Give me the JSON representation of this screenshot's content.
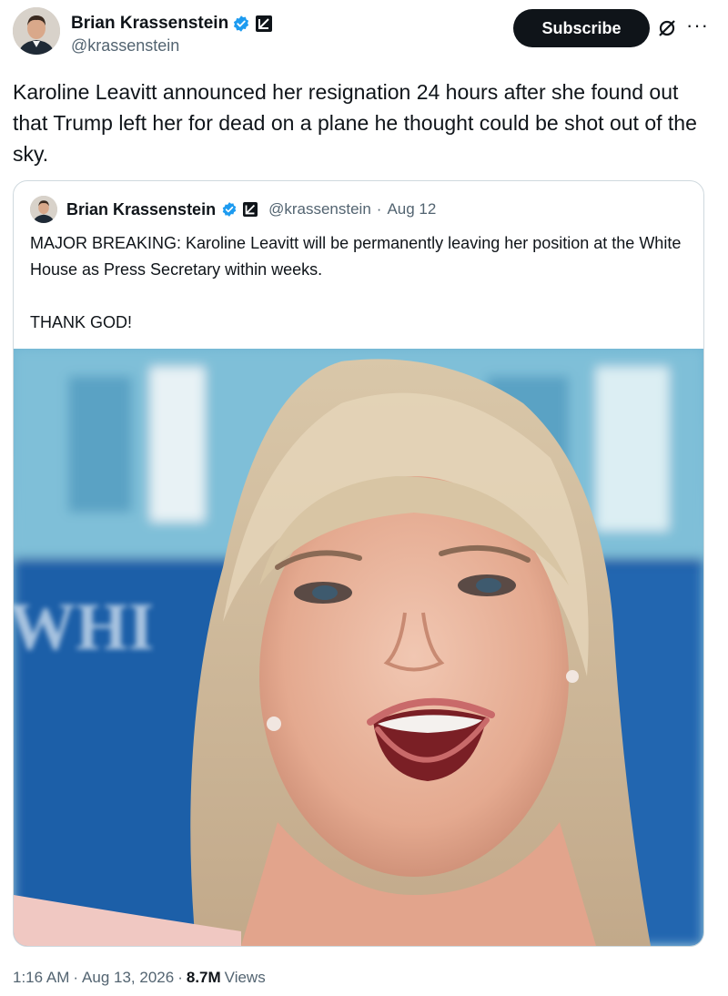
{
  "post": {
    "author_name": "Brian Krassenstein",
    "handle": "@krassenstein",
    "subscribe_label": "Subscribe",
    "more_label": "···",
    "text": "Karoline Leavitt announced her resignation 24 hours after she found out that Trump left her for dead on a plane he thought could be shot out of the sky.",
    "time": "1:16 AM",
    "date": "Aug 13, 2026",
    "separator": "·",
    "views_count": "8.7M",
    "views_label": "Views"
  },
  "quote": {
    "author_name": "Brian Krassenstein",
    "handle": "@krassenstein",
    "separator": "·",
    "date": "Aug 12",
    "text_line1": "MAJOR BREAKING:  Karoline Leavitt will be permanently leaving her position at the White House as Press Secretary within weeks.",
    "text_line2": "THANK GOD!",
    "background_sign_text": "WHI"
  },
  "colors": {
    "text": "#0f1419",
    "secondary": "#536471",
    "verified": "#1d9bf0",
    "border": "#cfd9de"
  },
  "icons": {
    "verified": "verified-badge-icon",
    "affiliate": "affiliate-badge-icon",
    "grok": "grok-icon",
    "more": "more-icon"
  }
}
